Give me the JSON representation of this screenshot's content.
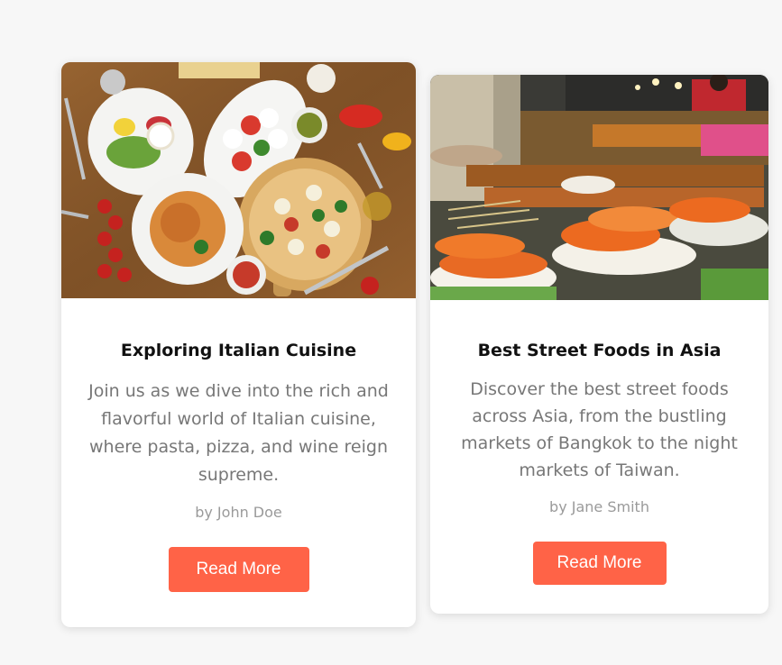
{
  "colors": {
    "background": "#f7f7f7",
    "card": "#ffffff",
    "button": "#ff6347",
    "title": "#111111",
    "text": "#777777",
    "author": "#9a9a9a"
  },
  "cards": [
    {
      "image_alt": "italian-food-image",
      "title": "Exploring Italian Cuisine",
      "text": "Join us as we dive into the rich and flavorful world of Italian cuisine, where pasta, pizza, and wine reign supreme.",
      "author": "by John Doe",
      "button_label": "Read More"
    },
    {
      "image_alt": "asian-street-food-image",
      "title": "Best Street Foods in Asia",
      "text": "Discover the best street foods across Asia, from the bustling markets of Bangkok to the night markets of Taiwan.",
      "author": "by Jane Smith",
      "button_label": "Read More"
    }
  ]
}
